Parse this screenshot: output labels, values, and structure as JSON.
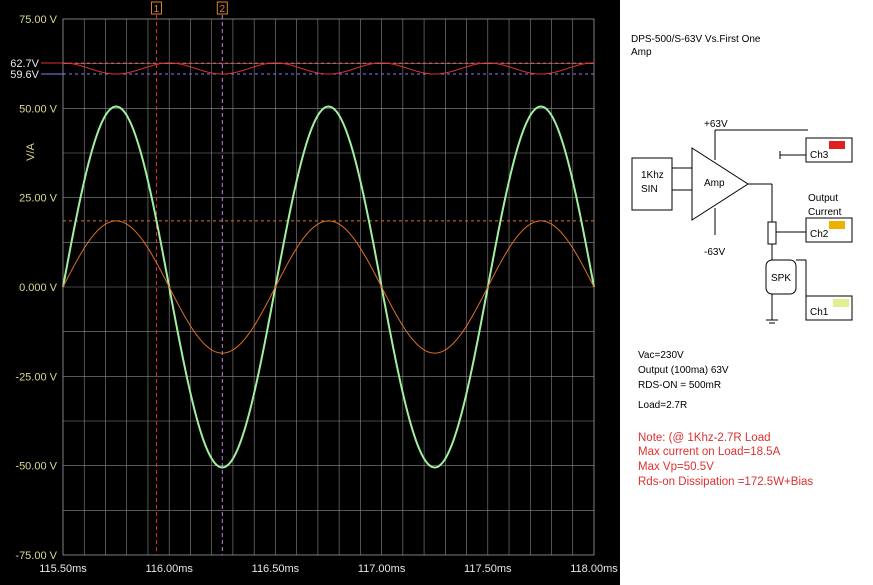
{
  "panel": {
    "title": "DPS-500/S-63V Vs.First One",
    "subtitle": "Amp",
    "specs": [
      "Vac=230V",
      "Output (100ma) 63V",
      "RDS-ON = 500mR",
      "Load=2.7R"
    ],
    "notes": [
      "Note: (@ 1Khz-2.7R Load",
      "Max current on Load=18.5A",
      "Max Vp=50.5V",
      "Rds-on Dissipation =172.5W+Bias"
    ],
    "schematic": {
      "vplus": "+63V",
      "vminus": "-63V",
      "source": "1Khz\nSIN",
      "source_l1": "1Khz",
      "source_l2": "SIN",
      "amp": "Amp",
      "output_current_l1": "Output",
      "output_current_l2": "Current",
      "spk": "SPK",
      "ch1": "Ch1",
      "ch2": "Ch2",
      "ch3": "Ch3"
    },
    "colors": {
      "ch3": "#e02020",
      "ch2": "#f0b000",
      "ch1": "#e0f090"
    }
  },
  "chart_data": {
    "type": "line",
    "ylabel": "V/A",
    "ylim": [
      -75,
      75
    ],
    "xlim": [
      115.5,
      118.0
    ],
    "x_ticks": [
      "115.50ms",
      "116.00ms",
      "116.50ms",
      "117.00ms",
      "117.50ms",
      "118.00ms"
    ],
    "y_ticks": [
      "75.00 V",
      "50.00 V",
      "25.00 V",
      "0.000 V",
      "-25.00 V",
      "-50.00 V",
      "-75.00 V"
    ],
    "y_tick_values": [
      75,
      50,
      25,
      0,
      -25,
      -50,
      -75
    ],
    "x_tick_values": [
      115.5,
      116.0,
      116.5,
      117.0,
      117.5,
      118.0
    ],
    "cursors": [
      {
        "label": "1",
        "x": 115.94,
        "color": "#e03030"
      },
      {
        "label": "2",
        "x": 116.25,
        "color": "#c080e0"
      }
    ],
    "levels": [
      {
        "label": "62.7V",
        "y": 62.7,
        "color": "#e03030"
      },
      {
        "label": "59.6V",
        "y": 59.6,
        "color": "#8080ff"
      },
      {
        "label": "",
        "y": 18.5,
        "color": "#e07020"
      }
    ],
    "series": [
      {
        "color": "#a0f0a0",
        "amplitude": 50.5,
        "frequency_khz": 1.0,
        "offset": 0,
        "start": 115.5
      },
      {
        "color": "#e07020",
        "amplitude": 18.5,
        "frequency_khz": 1.0,
        "offset": 0,
        "start": 115.5
      },
      {
        "color": "#e03030",
        "ripple_min": 59.6,
        "ripple_max": 62.7,
        "frequency_khz": 2.0,
        "start": 115.5
      }
    ],
    "grid": true,
    "colors": {
      "axis_text": "#d8d890",
      "grid": "#8a8a8a",
      "background": "#000000"
    }
  }
}
